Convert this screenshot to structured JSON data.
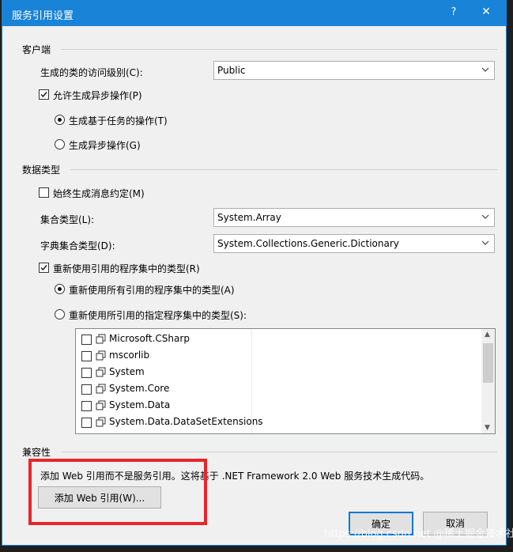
{
  "window": {
    "title": "服务引用设置",
    "help": "?",
    "close": "✕"
  },
  "client": {
    "group_label": "客户端",
    "access_level_label": "生成的类的访问级别(C):",
    "access_level_value": "Public",
    "allow_async_label": "允许生成异步操作(P)",
    "allow_async_checked": true,
    "task_based_label": "生成基于任务的操作(T)",
    "task_based_selected": true,
    "async_ops_label": "生成异步操作(G)",
    "async_ops_selected": false
  },
  "data_type": {
    "group_label": "数据类型",
    "always_msg_contract_label": "始终生成消息约定(M)",
    "always_msg_contract_checked": false,
    "collection_type_label": "集合类型(L):",
    "collection_type_value": "System.Array",
    "dict_collection_label": "字典集合类型(D):",
    "dict_collection_value": "System.Collections.Generic.Dictionary",
    "reuse_types_label": "重新使用引用的程序集中的类型(R)",
    "reuse_types_checked": true,
    "reuse_all_label": "重新使用所有引用的程序集中的类型(A)",
    "reuse_all_selected": true,
    "reuse_specified_label": "重新使用所引用的指定程序集中的类型(S):",
    "reuse_specified_selected": false,
    "assemblies": [
      {
        "name": "Microsoft.CSharp",
        "checked": false
      },
      {
        "name": "mscorlib",
        "checked": false
      },
      {
        "name": "System",
        "checked": false
      },
      {
        "name": "System.Core",
        "checked": false
      },
      {
        "name": "System.Data",
        "checked": false
      },
      {
        "name": "System.Data.DataSetExtensions",
        "checked": false
      }
    ]
  },
  "compat": {
    "group_label": "兼容性",
    "description": "添加 Web 引用而不是服务引用。这将基于 .NET Framework 2.0 Web 服务技术生成代码。",
    "add_web_ref_button": "添加 Web 引用(W)..."
  },
  "buttons": {
    "ok": "确定",
    "cancel": "取消"
  },
  "watermark": "https://blog.csdn.net @稀土掘金技术社区",
  "colors": {
    "titlebar": "#1883d7",
    "highlight_box": "#e8262a",
    "dialog_bg": "#f0f0f0"
  },
  "icons": [
    "close-icon",
    "help-icon",
    "dropdown-arrow-icon",
    "assembly-icon",
    "checkmark-icon"
  ]
}
